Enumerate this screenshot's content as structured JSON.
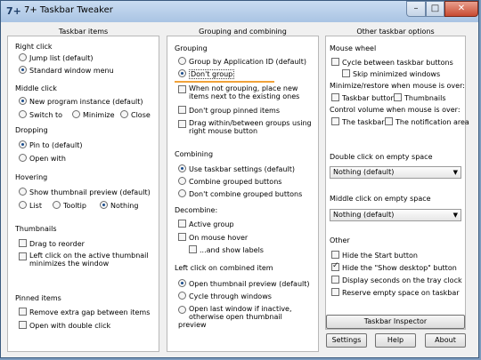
{
  "window": {
    "title": "7+ Taskbar Tweaker",
    "app_icon": "7+",
    "min": "–",
    "max": "□",
    "close": "✕"
  },
  "col1": {
    "header": "Taskbar items",
    "right_click": {
      "title": "Right click",
      "options": [
        "Jump list (default)",
        "Standard window menu"
      ]
    },
    "middle_click": {
      "title": "Middle click",
      "options": [
        "New program instance (default)",
        "Switch to",
        "Minimize",
        "Close"
      ]
    },
    "dropping": {
      "title": "Dropping",
      "options": [
        "Pin to (default)",
        "Open with"
      ]
    },
    "hovering": {
      "title": "Hovering",
      "options": [
        "Show thumbnail preview (default)",
        "List",
        "Tooltip",
        "Nothing"
      ]
    },
    "thumbnails": {
      "title": "Thumbnails",
      "options": [
        "Drag to reorder",
        "Left click on the active thumbnail minimizes the window"
      ]
    },
    "pinned": {
      "title": "Pinned items",
      "options": [
        "Remove extra gap between items",
        "Open with double click"
      ]
    }
  },
  "col2": {
    "header": "Grouping and combining",
    "grouping": {
      "title": "Grouping",
      "options": [
        "Group by Application ID (default)",
        "Don't group",
        "When not grouping, place new items next to the existing ones",
        "Don't group pinned items",
        "Drag within/between groups using right mouse button"
      ]
    },
    "combining": {
      "title": "Combining",
      "options": [
        "Use taskbar settings (default)",
        "Combine grouped buttons",
        "Don't combine grouped buttons"
      ]
    },
    "decombine": {
      "title": "Decombine:",
      "options": [
        "Active group",
        "On mouse hover",
        "...and show labels"
      ]
    },
    "left_click": {
      "title": "Left click on combined item",
      "options": [
        "Open thumbnail preview (default)",
        "Cycle through windows",
        "Open last window if inactive, otherwise open thumbnail preview"
      ]
    }
  },
  "col3": {
    "header": "Other taskbar options",
    "mouse_wheel": {
      "title": "Mouse wheel",
      "options": [
        "Cycle between taskbar buttons",
        "Skip minimized windows"
      ],
      "minimize_title": "Minimize/restore when mouse is over:",
      "minimize_options": [
        "Taskbar buttons",
        "Thumbnails"
      ],
      "volume_title": "Control volume when mouse is over:",
      "volume_options": [
        "The taskbar",
        "The notification area"
      ]
    },
    "double_click": {
      "title": "Double click on empty space",
      "value": "Nothing (default)"
    },
    "middle_empty": {
      "title": "Middle click on empty space",
      "value": "Nothing (default)"
    },
    "other": {
      "title": "Other",
      "options": [
        "Hide the Start button",
        "Hide the \"Show desktop\" button",
        "Display seconds on the tray clock",
        "Reserve empty space on taskbar"
      ]
    },
    "buttons": {
      "inspector": "Taskbar Inspector",
      "settings": "Settings",
      "help": "Help",
      "about": "About"
    }
  }
}
